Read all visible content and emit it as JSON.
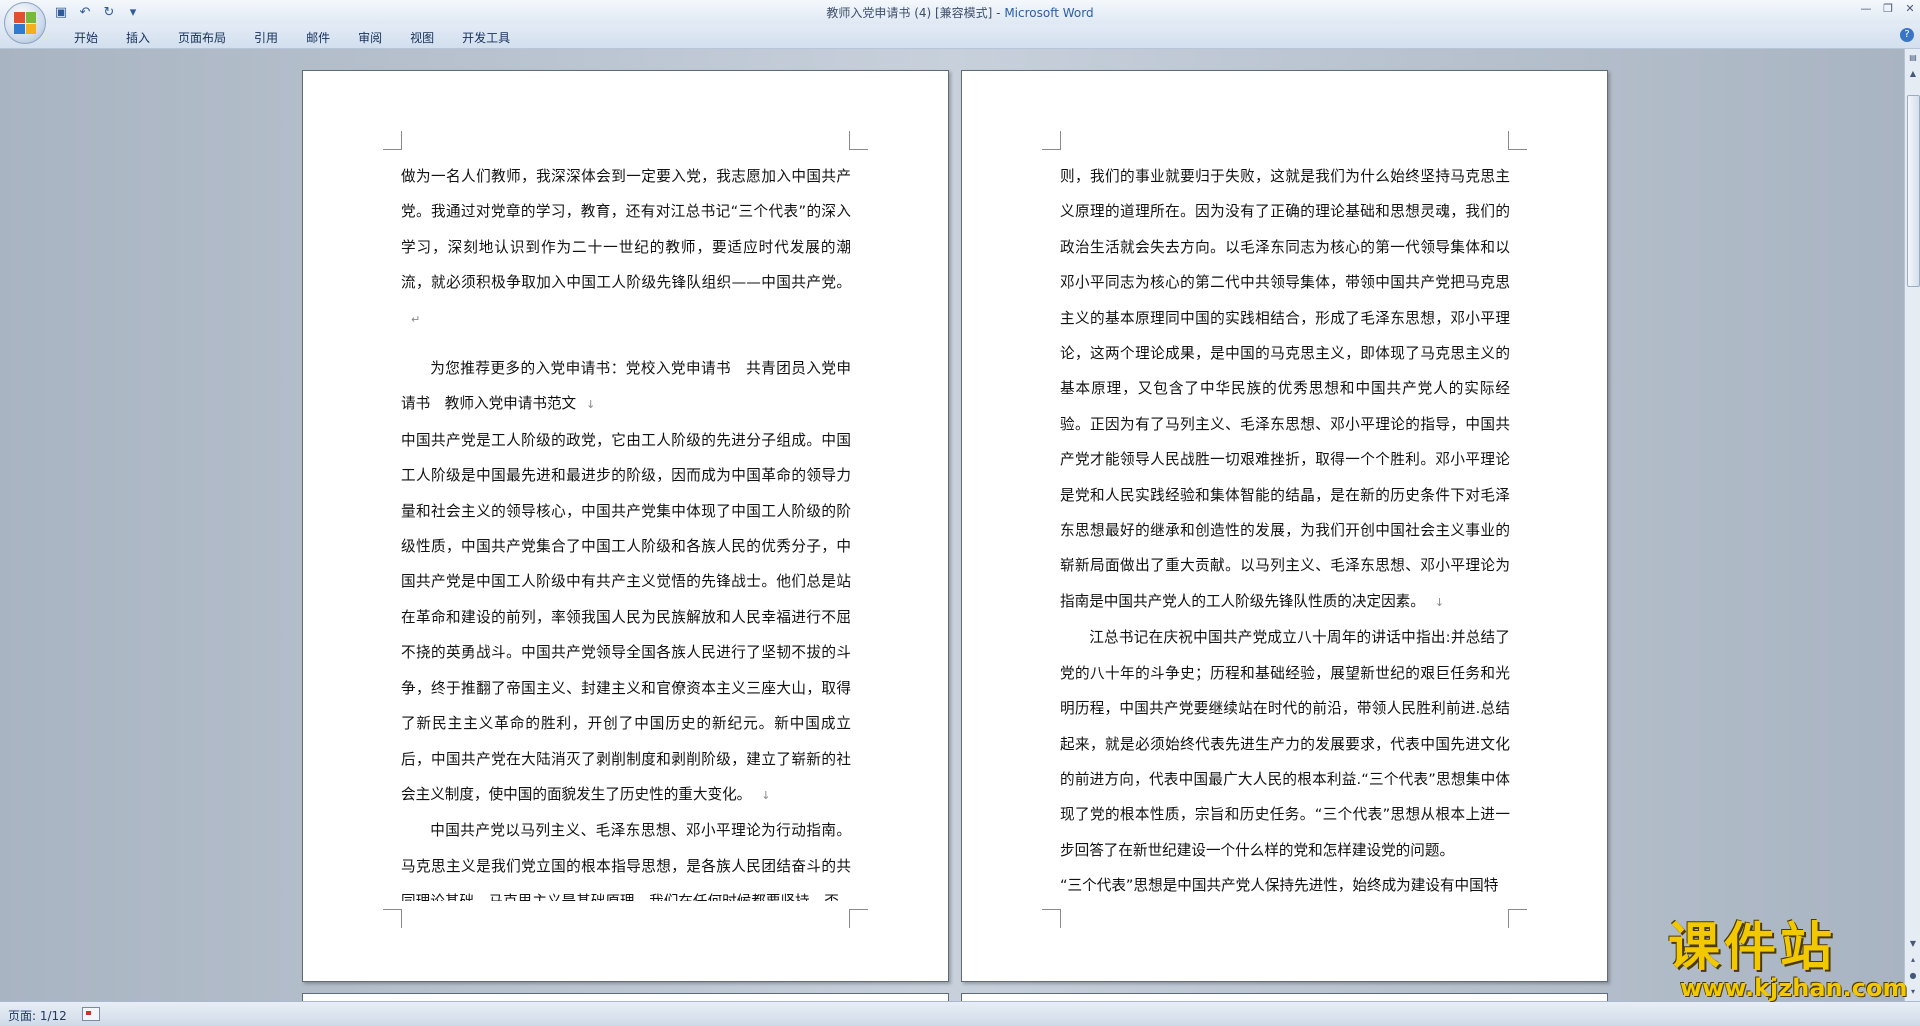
{
  "titlebar": {
    "doc_title": "教师入党申请书 (4) [兼容模式] - ",
    "app_name": "Microsoft Word",
    "qat": {
      "save": "save-icon",
      "undo": "undo-icon",
      "redo": "redo-icon",
      "more": "▾"
    }
  },
  "ribbon": {
    "tabs": [
      "开始",
      "插入",
      "页面布局",
      "引用",
      "邮件",
      "审阅",
      "视图",
      "开发工具"
    ],
    "help": "?"
  },
  "pages": {
    "left": {
      "paragraphs": [
        "做为一名人们教师，我深深体会到一定要入党，我志愿加入中国共产党。我通过对党章的学习，教育，还有对江总书记“三个代表”的深入学习，深刻地认识到作为二十一世纪的教师，要适应时代发展的潮流，就必须积极争取加入中国工人阶级先锋队组织——中国共产党。",
        "为您推荐更多的入党申请书：党校入党申请书　共青团员入党申请书　教师入党申请书范文",
        "中国共产党是工人阶级的政党，它由工人阶级的先进分子组成。中国工人阶级是中国最先进和最进步的阶级，因而成为中国革命的领导力量和社会主义的领导核心，中国共产党集中体现了中国工人阶级的阶级性质，中国共产党集合了中国工人阶级和各族人民的优秀分子，中国共产党是中国工人阶级中有共产主义觉悟的先锋战士。他们总是站在革命和建设的前列，率领我国人民为民族解放和人民幸福进行不屈不挠的英勇战斗。中国共产党领导全国各族人民进行了坚韧不拔的斗争，终于推翻了帝国主义、封建主义和官僚资本主义三座大山，取得了新民主主义革命的胜利，开创了中国历史的新纪元。新中国成立后，中国共产党在大陆消灭了剥削制度和剥削阶级，建立了崭新的社会主义制度，使中国的面貌发生了历史性的重大变化。",
        "中国共产党以马列主义、毛泽东思想、邓小平理论为行动指南。马克思主义是我们党立国的根本指导思想，是各族人民团结奋斗的共同理论基础。马克思主义是基础原理，我们在任何时候都要坚持，否"
      ]
    },
    "right": {
      "paragraphs": [
        "则，我们的事业就要归于失败，这就是我们为什么始终坚持马克思主义原理的道理所在。因为没有了正确的理论基础和思想灵魂，我们的政治生活就会失去方向。以毛泽东同志为核心的第一代领导集体和以邓小平同志为核心的第二代中共领导集体，带领中国共产党把马克思主义的基本原理同中国的实践相结合，形成了毛泽东思想，邓小平理论，这两个理论成果，是中国的马克思主义，即体现了马克思主义的基本原理，又包含了中华民族的优秀思想和中国共产党人的实际经验。正因为有了马列主义、毛泽东思想、邓小平理论的指导，中国共产党才能领导人民战胜一切艰难挫折，取得一个个胜利。邓小平理论是党和人民实践经验和集体智能的结晶，是在新的历史条件下对毛泽东思想最好的继承和创造性的发展，为我们开创中国社会主义事业的崭新局面做出了重大贡献。以马列主义、毛泽东思想、邓小平理论为指南是中国共产党人的工人阶级先锋队性质的决定因素。",
        "江总书记在庆祝中国共产党成立八十周年的讲话中指出:并总结了党的八十年的斗争史；历程和基础经验，展望新世纪的艰巨任务和光明历程，中国共产党要继续站在时代的前沿，带领人民胜利前进.总结起来，就是必须始终代表先进生产力的发展要求，代表中国先进文化的前进方向，代表中国最广大人民的根本利益.“三个代表”思想集中体现了党的根本性质，宗旨和历史任务。“三个代表”思想从根本上进一步回答了在新世纪建设一个什么样的党和怎样建设党的问题。",
        "“三个代表”思想是中国共产党人保持先进性，始终成为建设有中国特"
      ]
    },
    "para_marks": {
      "return": "↵",
      "down": "↓"
    }
  },
  "statusbar": {
    "page_info": "页面: 1/12"
  },
  "watermark": {
    "title": "课件站",
    "url": "www.kjzhan.com"
  },
  "colors": {
    "watermark": "#f2c800",
    "ribbon": "#d3dfee",
    "app_title": "#2a5ea8"
  }
}
